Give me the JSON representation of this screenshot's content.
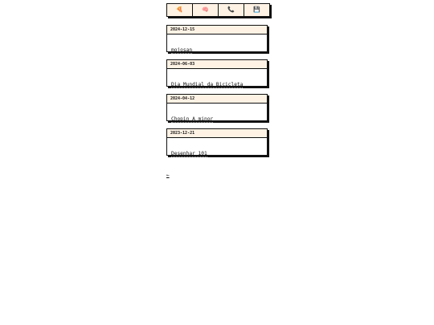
{
  "nav": {
    "buttons": [
      {
        "icon": "pizza-icon",
        "glyph": "🍕"
      },
      {
        "icon": "brain-icon",
        "glyph": "🧠"
      },
      {
        "icon": "phone-icon",
        "glyph": "📞"
      },
      {
        "icon": "floppy-disk-icon",
        "glyph": "💾"
      }
    ]
  },
  "entries": [
    {
      "date": "2024-12-15",
      "title": "mojosan"
    },
    {
      "date": "2024-06-03",
      "title": "Dia Mundial da Bicicleta"
    },
    {
      "date": "2024-04-12",
      "title": "Chopin A minor"
    },
    {
      "date": "2023-12-21",
      "title": "Desenhar 101"
    }
  ],
  "footer": {
    "back_label": "←"
  }
}
